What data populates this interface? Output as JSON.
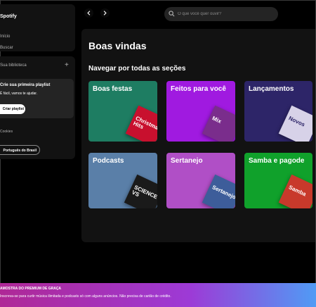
{
  "sidebar": {
    "brand": "Spotify",
    "nav": [
      "Início",
      "Buscar"
    ],
    "library_title": "Sua biblioteca",
    "card": {
      "title": "Crie sua primeira playlist",
      "text": "É fácil, vamos te ajudar.",
      "button": "Criar playlist"
    },
    "links_text": "Cookies",
    "language_button": "Português do Brasil"
  },
  "header": {
    "back_icon": "chevron-left-icon",
    "forward_icon": "chevron-right-icon",
    "search_placeholder": "O que você quer ouvir?"
  },
  "main": {
    "title": "Boas vindas",
    "section_title": "Navegar por todas as seções",
    "tiles": [
      {
        "label": "Boas festas",
        "color": "#1e7d62",
        "art_text": "Christmas Hits"
      },
      {
        "label": "Feitos para você",
        "color": "#a01ae0",
        "art_text": "Mix"
      },
      {
        "label": "Lançamentos",
        "color": "#2d2568",
        "art_text": "Novos"
      },
      {
        "label": "Podcasts",
        "color": "#5a7fa8",
        "art_text": "SCIENCE VS"
      },
      {
        "label": "Sertanejo",
        "color": "#b04fc6",
        "art_text": "Sertanejo"
      },
      {
        "label": "Samba e pagode",
        "color": "#10a12b",
        "art_text": "Samba"
      }
    ]
  },
  "banner": {
    "title": "AMOSTRA DO PREMIUM DE GRAÇA",
    "text": "Inscreva-se para curtir música ilimitada e podcasts só com alguns anúncios. Não precisa de cartão de crédito."
  }
}
